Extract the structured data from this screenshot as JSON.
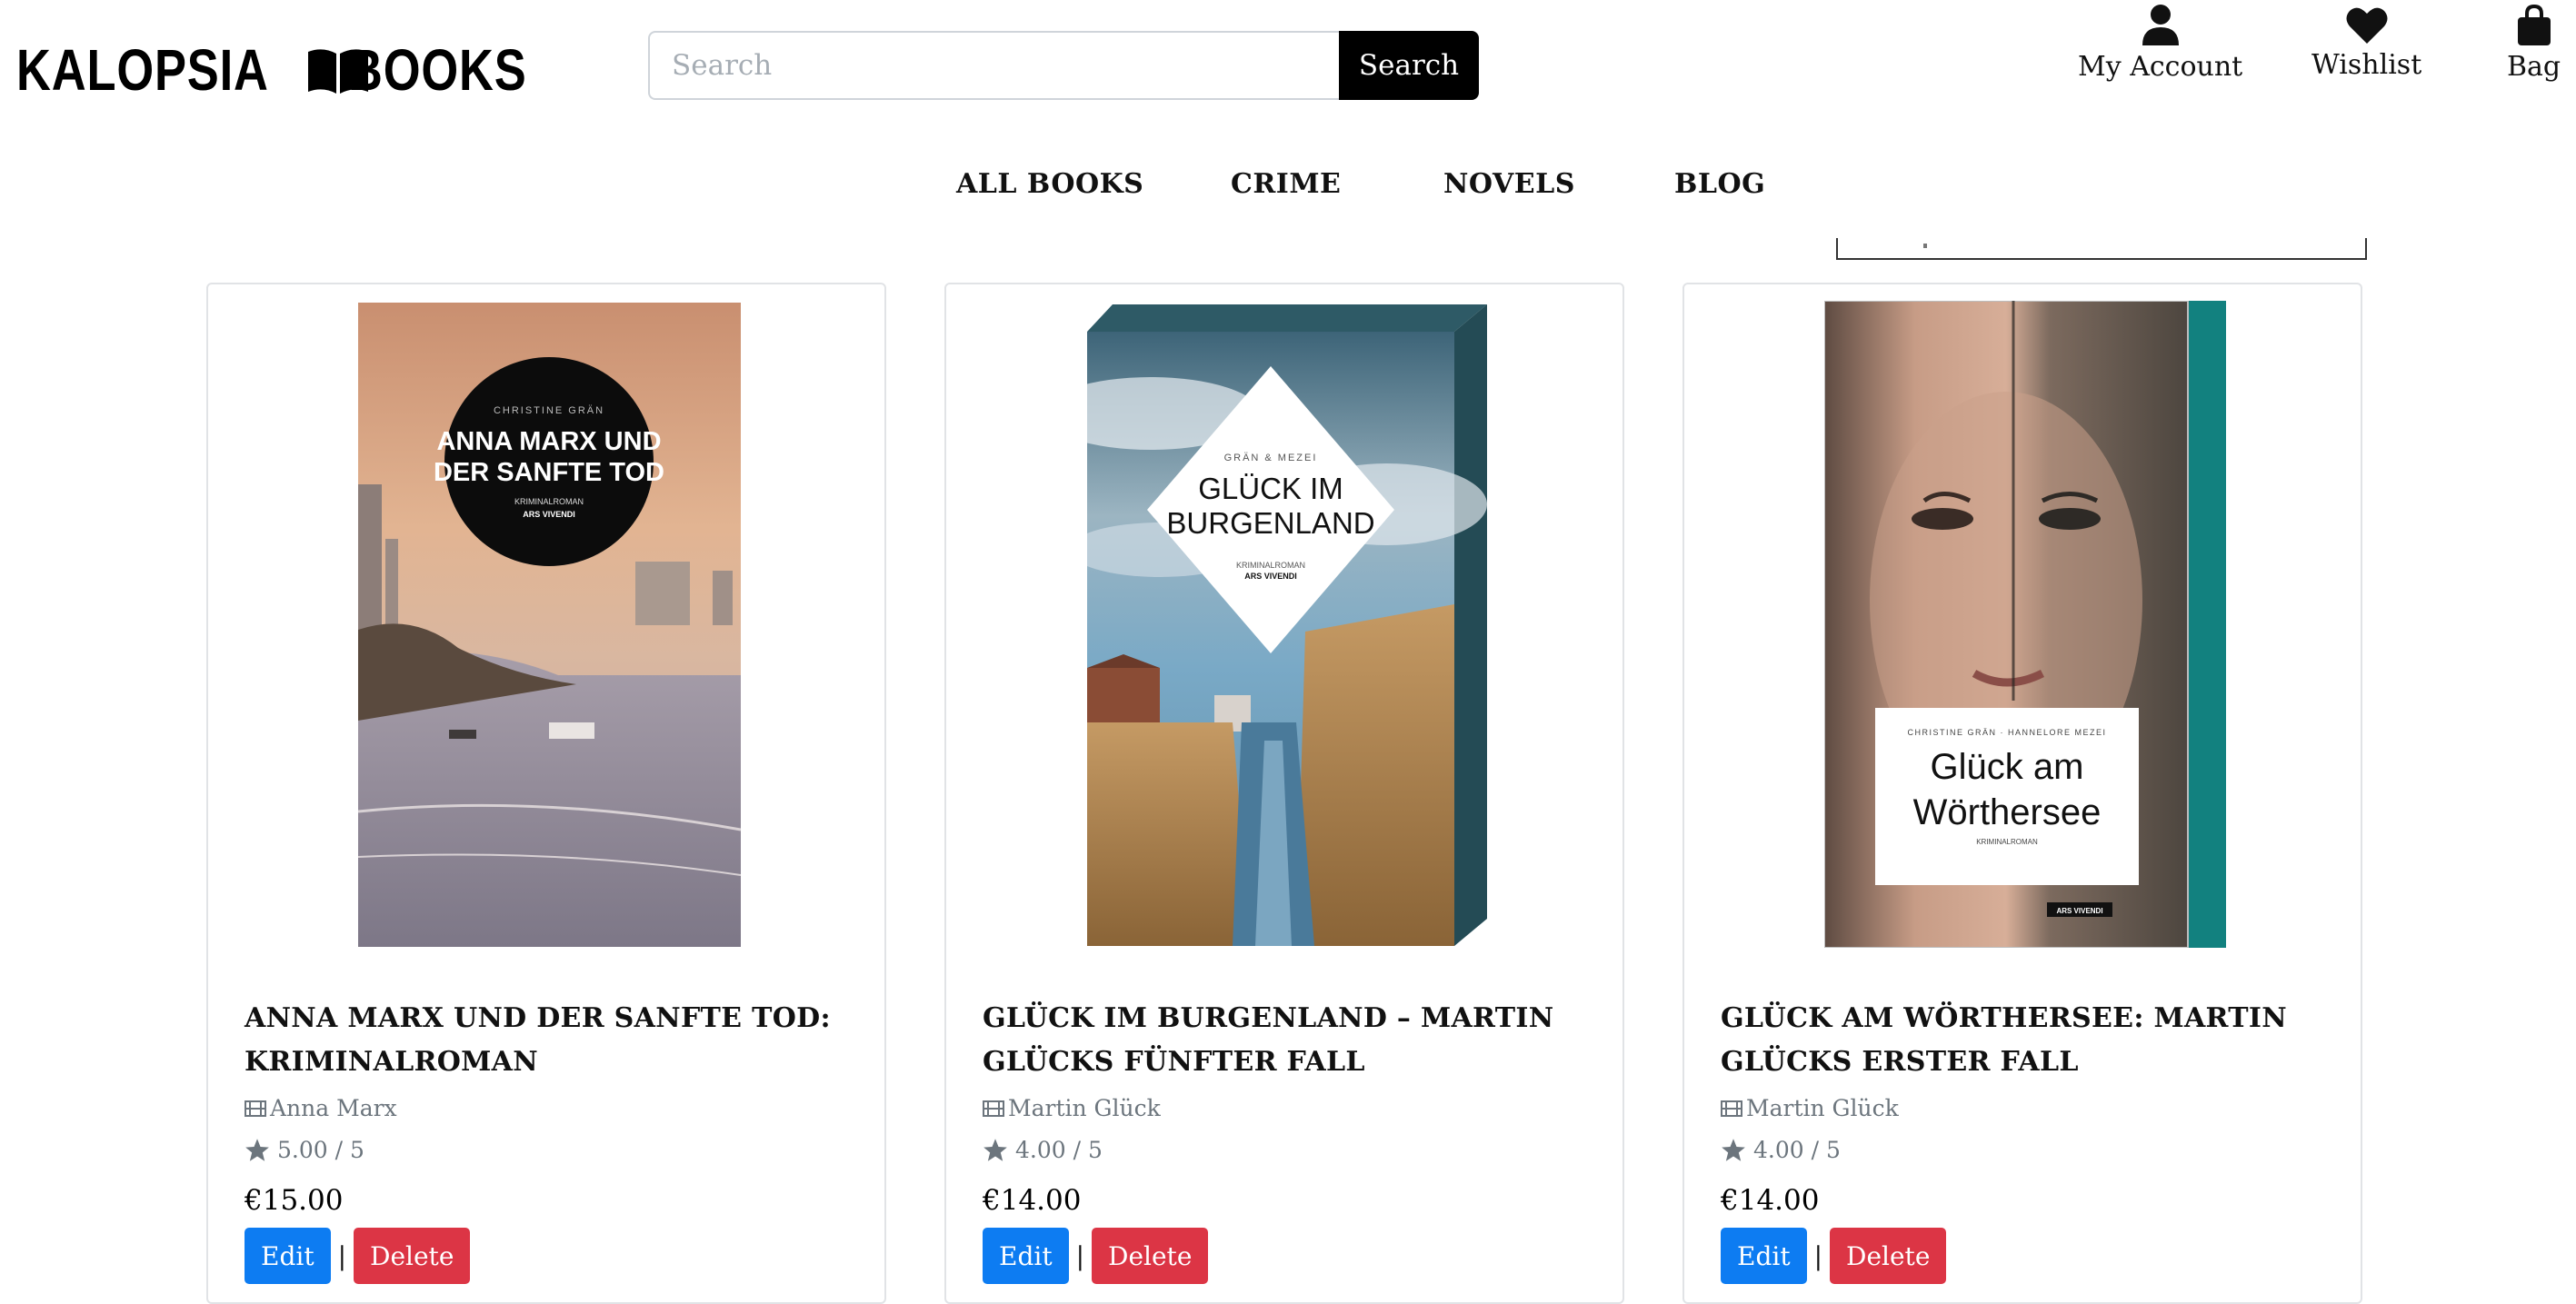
{
  "header": {
    "logo_left": "KALOPSIA",
    "logo_right": "BOOKS",
    "search_placeholder": "Search",
    "search_button": "Search",
    "my_account": "My Account",
    "wishlist": "Wishlist",
    "bag": "Bag"
  },
  "nav": {
    "all_books": "ALL BOOKS",
    "crime": "CRIME",
    "novels": "NOVELS",
    "blog": "BLOG"
  },
  "products": [
    {
      "cover": {
        "author": "CHRISTINE GRÄN",
        "title_line1": "ANNA MARX UND",
        "title_line2": "DER SANFTE TOD",
        "genre": "KRIMINALROMAN",
        "publisher": "ARS VIVENDI"
      },
      "title": "ANNA MARX UND DER SANFTE TOD: KRIMINALROMAN",
      "author": "Anna Marx",
      "rating": "5.00 / 5",
      "price": "€15.00",
      "edit_label": "Edit",
      "delete_label": "Delete",
      "separator": "|"
    },
    {
      "cover": {
        "author": "GRÄN & MEZEI",
        "title_line1": "GLÜCK IM",
        "title_line2": "BURGENLAND",
        "genre": "KRIMINALROMAN",
        "publisher": "ARS VIVENDI"
      },
      "title": "GLÜCK IM BURGENLAND – MARTIN GLÜCKS FÜNFTER FALL",
      "author": "Martin Glück",
      "rating": "4.00 / 5",
      "price": "€14.00",
      "edit_label": "Edit",
      "delete_label": "Delete",
      "separator": "|"
    },
    {
      "cover": {
        "author": "CHRISTINE GRÄN · HANNELORE MEZEI",
        "title_line1": "Glück am",
        "title_line2": "Wörthersee",
        "genre": "KRIMINALROMAN",
        "publisher": "ARS VIVENDI"
      },
      "title": "GLÜCK AM WÖRTHERSEE: MARTIN GLÜCKS ERSTER FALL",
      "author": "Martin Glück",
      "rating": "4.00 / 5",
      "price": "€14.00",
      "edit_label": "Edit",
      "delete_label": "Delete",
      "separator": "|"
    }
  ],
  "colors": {
    "edit_button": "#0d7cf2",
    "delete_button": "#dc3545",
    "muted_text": "#6c757d",
    "search_button": "#000000"
  },
  "icons": [
    "book-logo-icon",
    "user-icon",
    "heart-icon",
    "bag-icon",
    "film-icon",
    "star-icon"
  ]
}
